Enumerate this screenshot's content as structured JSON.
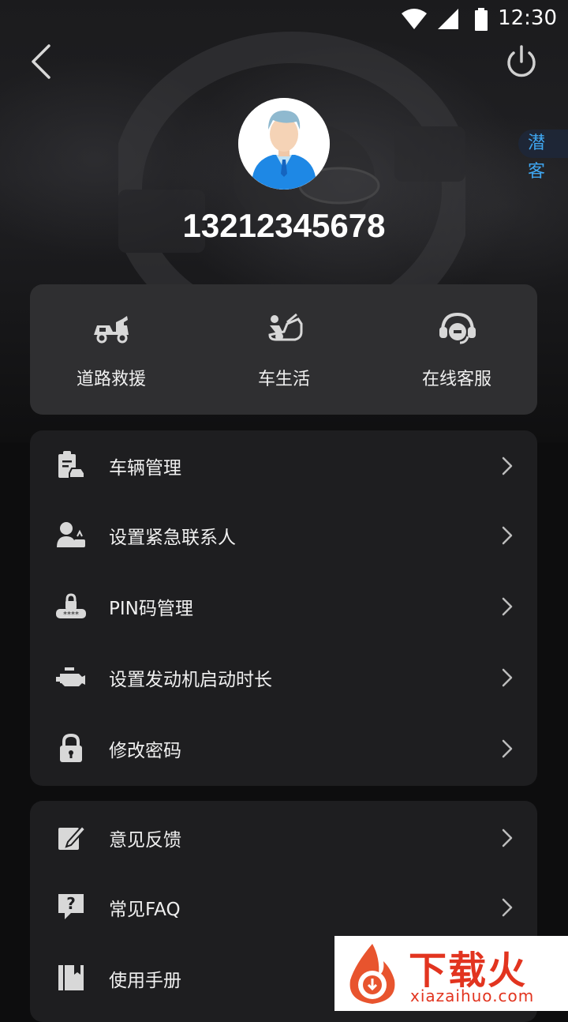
{
  "status": {
    "time": "12:30"
  },
  "profile": {
    "phone": "13212345678",
    "tag": "潜客"
  },
  "quick_actions": [
    {
      "label": "道路救援",
      "icon": "tow-truck-icon"
    },
    {
      "label": "车生活",
      "icon": "car-service-icon"
    },
    {
      "label": "在线客服",
      "icon": "headset-icon"
    }
  ],
  "menu_group1": [
    {
      "label": "车辆管理",
      "icon": "vehicle-clipboard-icon"
    },
    {
      "label": "设置紧急联系人",
      "icon": "emergency-contact-icon"
    },
    {
      "label": "PIN码管理",
      "icon": "pin-lock-icon"
    },
    {
      "label": "设置发动机启动时长",
      "icon": "engine-icon"
    },
    {
      "label": "修改密码",
      "icon": "padlock-icon"
    }
  ],
  "menu_group2": [
    {
      "label": "意见反馈",
      "icon": "edit-icon"
    },
    {
      "label": "常见FAQ",
      "icon": "faq-icon"
    },
    {
      "label": "使用手册",
      "icon": "manual-icon"
    }
  ],
  "watermark": {
    "title": "下载火",
    "subtitle": "xiazaihuo.com"
  },
  "colors": {
    "tag_text": "#3fa6f0",
    "card_top": "#2f2f31",
    "card": "#1e1e20",
    "watermark_red": "#e2341f"
  }
}
